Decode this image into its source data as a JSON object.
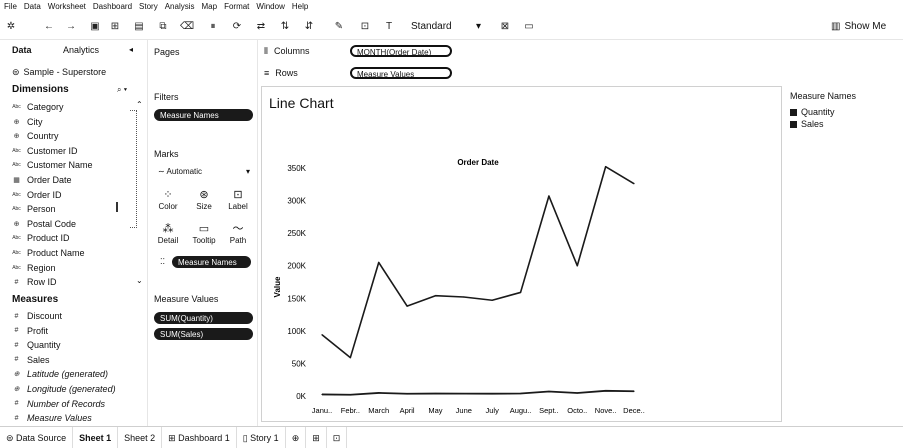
{
  "menu": [
    "File",
    "Data",
    "Worksheet",
    "Dashboard",
    "Story",
    "Analysis",
    "Map",
    "Format",
    "Window",
    "Help"
  ],
  "toolbar": {
    "fit_select": "Standard",
    "show_me": "Show Me"
  },
  "data_pane": {
    "tab_data": "Data",
    "tab_analytics": "Analytics",
    "datasource": "Sample - Superstore",
    "dimensions_label": "Dimensions",
    "dimensions": [
      {
        "name": "Category",
        "icon": "Abc"
      },
      {
        "name": "City",
        "icon": "globe"
      },
      {
        "name": "Country",
        "icon": "globe"
      },
      {
        "name": "Customer ID",
        "icon": "Abc"
      },
      {
        "name": "Customer Name",
        "icon": "Abc"
      },
      {
        "name": "Order Date",
        "icon": "date"
      },
      {
        "name": "Order ID",
        "icon": "Abc"
      },
      {
        "name": "Person",
        "icon": "Abc"
      },
      {
        "name": "Postal Code",
        "icon": "globe"
      },
      {
        "name": "Product ID",
        "icon": "Abc"
      },
      {
        "name": "Product Name",
        "icon": "Abc"
      },
      {
        "name": "Region",
        "icon": "Abc"
      },
      {
        "name": "Row ID",
        "icon": "#"
      }
    ],
    "measures_label": "Measures",
    "measures": [
      {
        "name": "Discount",
        "icon": "#",
        "italic": false
      },
      {
        "name": "Profit",
        "icon": "#",
        "italic": false
      },
      {
        "name": "Quantity",
        "icon": "#",
        "italic": false
      },
      {
        "name": "Sales",
        "icon": "#",
        "italic": false
      },
      {
        "name": "Latitude (generated)",
        "icon": "globe",
        "italic": true
      },
      {
        "name": "Longitude (generated)",
        "icon": "globe",
        "italic": true
      },
      {
        "name": "Number of Records",
        "icon": "#",
        "italic": true
      },
      {
        "name": "Measure Values",
        "icon": "#",
        "italic": true
      }
    ]
  },
  "cards": {
    "pages": "Pages",
    "filters": "Filters",
    "filter_pill": "Measure Names",
    "marks": "Marks",
    "marks_type": "Automatic",
    "mark_buttons": [
      "Color",
      "Size",
      "Label",
      "Detail",
      "Tooltip",
      "Path"
    ],
    "marks_pill": "Measure Names",
    "measure_values": "Measure Values",
    "mv_pills": [
      "SUM(Quantity)",
      "SUM(Sales)"
    ]
  },
  "shelves": {
    "columns_label": "Columns",
    "columns_pill": "MONTH(Order Date)",
    "rows_label": "Rows",
    "rows_pill": "Measure Values"
  },
  "view": {
    "title": "Line Chart"
  },
  "legend": {
    "title": "Measure Names",
    "items": [
      "Quantity",
      "Sales"
    ]
  },
  "bottom_tabs": [
    "Data Source",
    "Sheet 1",
    "Sheet 2",
    "Dashboard 1",
    "Story 1"
  ],
  "chart_data": {
    "type": "line",
    "title": "Order Date",
    "xlabel": "",
    "ylabel": "Value",
    "categories": [
      "Janu..",
      "Febr..",
      "March",
      "April",
      "May",
      "June",
      "July",
      "Augu..",
      "Sept..",
      "Octo..",
      "Nove..",
      "Dece.."
    ],
    "ylim": [
      0,
      370000
    ],
    "yticks": [
      0,
      50000,
      100000,
      150000,
      200000,
      250000,
      300000,
      350000
    ],
    "ytick_labels": [
      "0K",
      "50K",
      "100K",
      "150K",
      "200K",
      "250K",
      "300K",
      "350K"
    ],
    "series": [
      {
        "name": "Sales",
        "values": [
          94000,
          59000,
          205000,
          138000,
          154000,
          152000,
          147000,
          159000,
          307000,
          200000,
          352000,
          326000
        ]
      },
      {
        "name": "Quantity",
        "values": [
          2371,
          1908,
          4699,
          3458,
          3740,
          3669,
          3565,
          3785,
          6893,
          4562,
          7948,
          7260
        ]
      }
    ],
    "grid": false
  }
}
